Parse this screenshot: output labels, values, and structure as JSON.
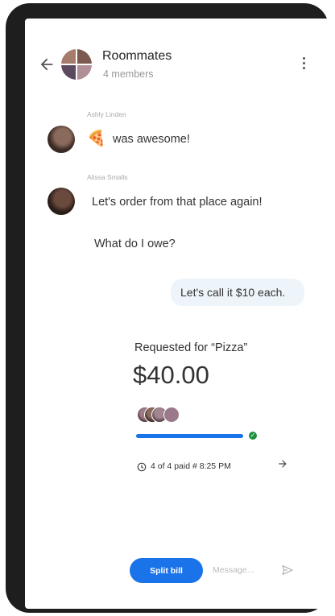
{
  "header": {
    "title": "Roommates",
    "subtitle": "4 members"
  },
  "messages": [
    {
      "sender": "Ashly Linden",
      "text": "was awesome!",
      "emoji": "🍕"
    },
    {
      "sender": "Alissa Smalls",
      "lines": [
        "Let's order from that place again!",
        "What do I owe?"
      ]
    },
    {
      "outgoing": "Let's call it $10 each."
    }
  ],
  "request": {
    "title": "Requested for “Pizza”",
    "amount": "$40.00",
    "paid_fraction": 1.0,
    "status": "4 of 4 paid # 8:25 PM"
  },
  "composer": {
    "split_label": "Split bill",
    "placeholder": "Message..."
  },
  "colors": {
    "accent": "#1a73e8",
    "success": "#1e8e3e",
    "bubble": "#eef5fa"
  },
  "icons": [
    "back-arrow-icon",
    "more-vert-icon",
    "clock-icon",
    "arrow-forward-icon",
    "send-icon",
    "check-icon",
    "pizza-icon"
  ]
}
